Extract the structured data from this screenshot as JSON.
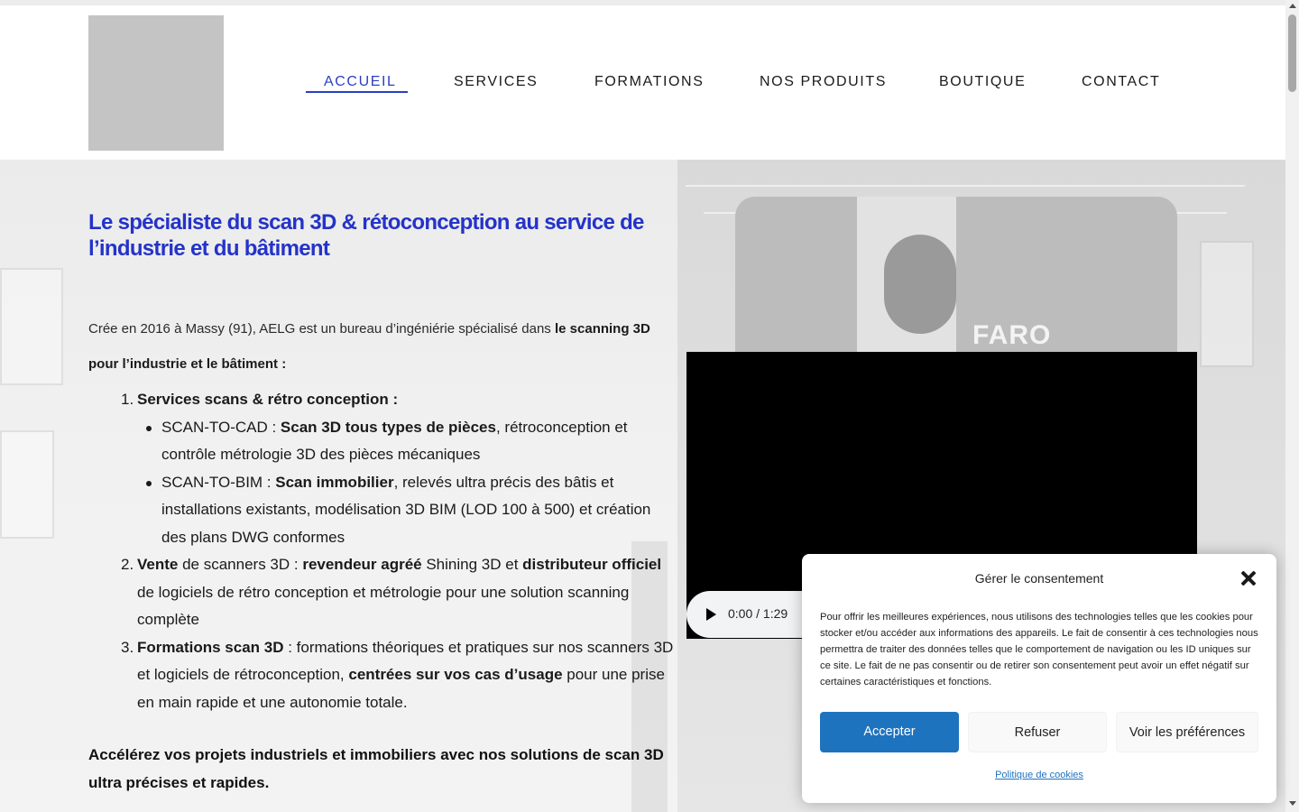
{
  "nav": {
    "items": [
      {
        "label": "ACCUEIL",
        "active": true
      },
      {
        "label": "SERVICES",
        "active": false
      },
      {
        "label": "FORMATIONS",
        "active": false
      },
      {
        "label": "NOS PRODUITS",
        "active": false
      },
      {
        "label": "BOUTIQUE",
        "active": false
      },
      {
        "label": "CONTACT",
        "active": false
      }
    ]
  },
  "hero": {
    "headline": "Le spécialiste du scan 3D & rétoconception au service de l’industrie et du bâtiment",
    "scanner_brand": "FARO",
    "intro_prefix": "Crée en 2016 à Massy (91), AELG est un bureau d’ingéniérie spécialisé dans ",
    "intro_bold": "le scanning 3D pour l’industrie et le bâtiment :",
    "list": {
      "item1": {
        "num": "1.",
        "title": "Services scans & rétro conception :",
        "sub1_prefix": "SCAN-TO-CAD : ",
        "sub1_bold": "Scan 3D tous types de pièces",
        "sub1_rest": ", rétroconception et contrôle métrologie 3D des pièces mécaniques",
        "sub2_prefix": "SCAN-TO-BIM : ",
        "sub2_bold": "Scan immobilier",
        "sub2_rest": ", relevés ultra précis des bâtis et installations existants, modélisation 3D BIM (LOD 100 à 500) et création des plans DWG conformes"
      },
      "item2": {
        "num": "2.",
        "bold1": "Vente",
        "text1": " de scanners 3D : ",
        "bold2": "revendeur agréé",
        "text2": " Shining 3D et ",
        "bold3": "distributeur officiel",
        "text3": " de logiciels de rétro conception et métrologie pour une solution scanning complète"
      },
      "item3": {
        "num": "3.",
        "bold1": "Formations scan 3D",
        "text1": " : formations théoriques et pratiques sur nos scanners 3D et logiciels de rétroconception, ",
        "bold2": "centrées sur vos cas d’usage",
        "text2": " pour une prise en main rapide et une autonomie totale."
      }
    },
    "closing": "Accélérez vos projets industriels et immobiliers avec nos solutions de scan 3D ultra précises et rapides."
  },
  "video": {
    "time": "0:00 / 1:29",
    "play_icon": "play-icon"
  },
  "consent": {
    "title": "Gérer le consentement",
    "text": "Pour offrir les meilleures expériences, nous utilisons des technologies telles que les cookies pour stocker et/ou accéder aux informations des appareils. Le fait de consentir à ces technologies nous permettra de traiter des données telles que le comportement de navigation ou les ID uniques sur ce site. Le fait de ne pas consentir ou de retirer son consentement peut avoir un effet négatif sur certaines caractéristiques et fonctions.",
    "accept_label": "Accepter",
    "refuse_label": "Refuser",
    "prefs_label": "Voir les préférences",
    "policy_label": "Politique de cookies"
  },
  "colors": {
    "accent": "#2b3fc1",
    "headline": "#2433c8",
    "button_primary": "#1e73be"
  }
}
